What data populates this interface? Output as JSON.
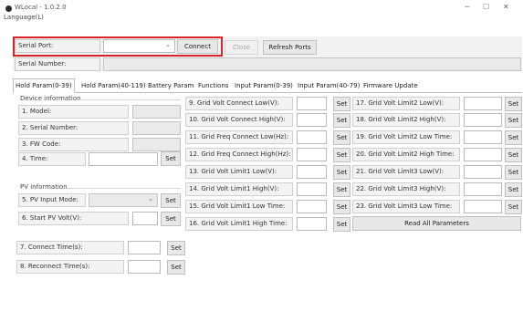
{
  "window": {
    "title": "WLocal - 1.0.2.0",
    "controls": {
      "minimize": "−",
      "maximize": "☐",
      "close": "✕"
    }
  },
  "menu": {
    "language": "Language(L)"
  },
  "top": {
    "serial_port_label": "Serial Port:",
    "serial_port_value": "",
    "connect": "Connect",
    "close": "Close",
    "refresh": "Refresh Ports",
    "serial_number_label": "Serial Number:",
    "serial_number_value": ""
  },
  "tabs": [
    "Hold Param(0-39)",
    "Hold Param(40-119)",
    "Battery Param",
    "Functions",
    "Input Param(0-39)",
    "Input Param(40-79)",
    "Firmware Update"
  ],
  "device": {
    "title": "Device information",
    "rows": [
      "1. Model:",
      "2. Serial Number:",
      "3. FW Code:",
      "4. Time:"
    ],
    "set": "Set"
  },
  "pv": {
    "title": "PV information",
    "rows": [
      "5. PV Input Mode:",
      "6. Start PV Volt(V):"
    ],
    "set": "Set"
  },
  "connect_rows": [
    "7. Connect Time(s):",
    "8. Reconnect Time(s):"
  ],
  "mid_params": [
    "9. Grid Volt Connect Low(V):",
    "10. Grid Volt Connect High(V):",
    "11. Grid Freq Connect Low(Hz):",
    "12. Grid Freq Connect High(Hz):",
    "13. Grid Volt Limit1 Low(V):",
    "14. Grid Volt Limit1 High(V):",
    "15. Grid Volt Limit1 Low Time:",
    "16. Grid Volt Limit1 High Time:"
  ],
  "right_params": [
    "17. Grid Volt Limit2 Low(V):",
    "18. Grid Volt Limit2 High(V):",
    "19. Grid Volt Limit2 Low Time:",
    "20. Grid Volt Limit2 High Time:",
    "21. Grid Volt Limit3 Low(V):",
    "22. Grid Volt Limit3 High(V):",
    "23. Grid Volt Limit3 Low Time:"
  ],
  "set_label": "Set",
  "read_all": "Read All Parameters",
  "colors": {
    "highlight": "#d9232a"
  },
  "icons": {
    "app": "app-logo-icon",
    "dropdown": "chevron-down-icon"
  }
}
